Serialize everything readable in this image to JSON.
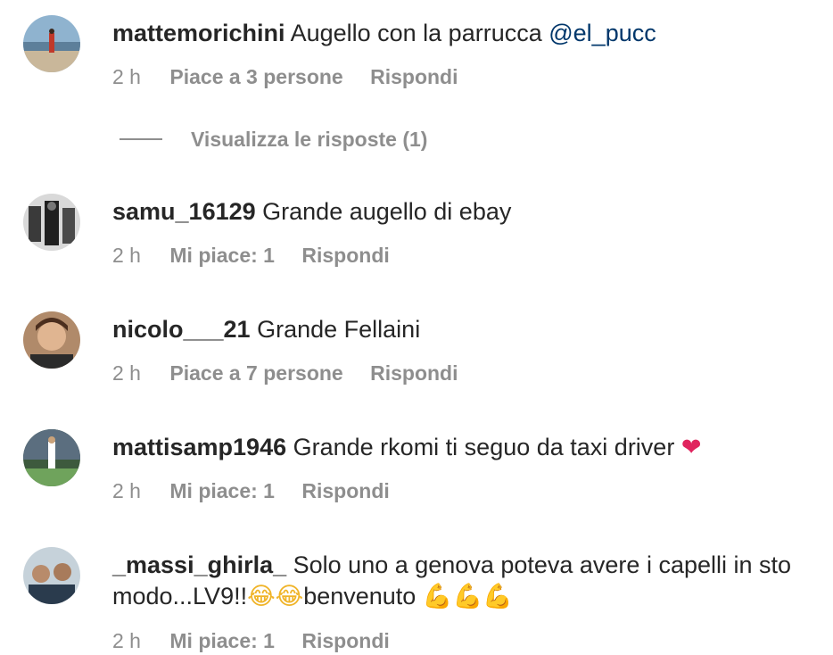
{
  "comments": [
    {
      "username": "mattemorichini",
      "text": "Augello con la parrucca",
      "mention": "@el_pucc",
      "time": "2 h",
      "likes": "Piace a 3 persone",
      "reply": "Rispondi"
    },
    {
      "username": "samu_16129",
      "text": "Grande augello di ebay",
      "time": "2 h",
      "likes": "Mi piace: 1",
      "reply": "Rispondi"
    },
    {
      "username": "nicolo___21",
      "text": "Grande Fellaini",
      "time": "2 h",
      "likes": "Piace a 7 persone",
      "reply": "Rispondi"
    },
    {
      "username": "mattisamp1946",
      "text": "Grande rkomi ti seguo da taxi driver",
      "emoji": "❤",
      "time": "2 h",
      "likes": "Mi piace: 1",
      "reply": "Rispondi"
    },
    {
      "username": "_massi_ghirla_",
      "text": "Solo uno a genova poteva avere i capelli in sto modo...LV9!!",
      "emoji_laugh": "😂😂",
      "text_after": "benvenuto",
      "emoji_muscle": "💪💪💪",
      "time": "2 h",
      "likes": "Mi piace: 1",
      "reply": "Rispondi"
    }
  ],
  "view_replies": "Visualizza le risposte (1)"
}
